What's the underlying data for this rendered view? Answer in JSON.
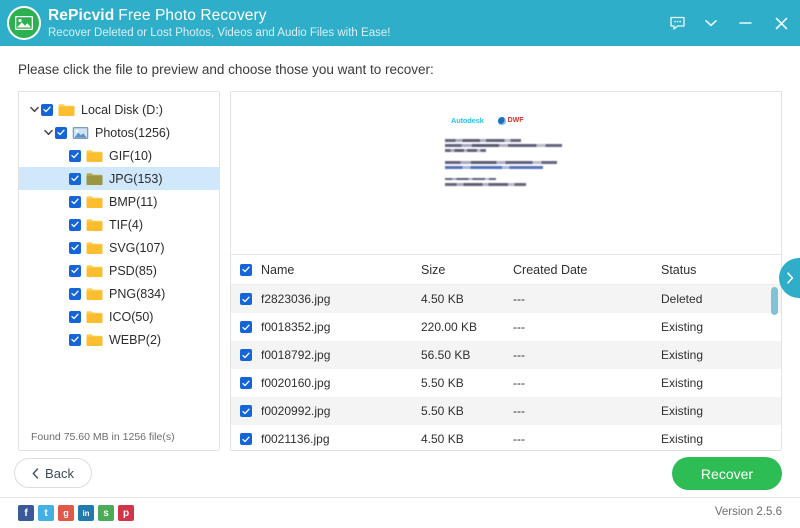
{
  "window": {
    "brand": "RePicvid",
    "product": "Free Photo Recovery",
    "tagline": "Recover Deleted or Lost Photos, Videos and Audio Files with Ease!",
    "logo_icon": "photo-icon",
    "controls": [
      {
        "name": "feedback-button",
        "icon": "chat-bubble-icon"
      },
      {
        "name": "menu-button",
        "icon": "chevron-down-icon"
      },
      {
        "name": "minimize-button",
        "icon": "minimize-icon"
      },
      {
        "name": "close-button",
        "icon": "close-icon"
      }
    ],
    "header_color": "#2eaec8"
  },
  "instruction": "Please click the file to preview and choose those you want to recover:",
  "tree": {
    "items": [
      {
        "label": "Local Disk (D:)",
        "depth": 0,
        "checked": true,
        "expanded": true,
        "icon": "folder-icon",
        "selected": false
      },
      {
        "label": "Photos(1256)",
        "depth": 1,
        "checked": true,
        "expanded": true,
        "icon": "picture-icon",
        "selected": false
      },
      {
        "label": "GIF(10)",
        "depth": 2,
        "checked": true,
        "expanded": null,
        "icon": "folder-icon",
        "selected": false
      },
      {
        "label": "JPG(153)",
        "depth": 2,
        "checked": true,
        "expanded": null,
        "icon": "folder-icon-selected",
        "selected": true
      },
      {
        "label": "BMP(11)",
        "depth": 2,
        "checked": true,
        "expanded": null,
        "icon": "folder-icon",
        "selected": false
      },
      {
        "label": "TIF(4)",
        "depth": 2,
        "checked": true,
        "expanded": null,
        "icon": "folder-icon",
        "selected": false
      },
      {
        "label": "SVG(107)",
        "depth": 2,
        "checked": true,
        "expanded": null,
        "icon": "folder-icon",
        "selected": false
      },
      {
        "label": "PSD(85)",
        "depth": 2,
        "checked": true,
        "expanded": null,
        "icon": "folder-icon",
        "selected": false
      },
      {
        "label": "PNG(834)",
        "depth": 2,
        "checked": true,
        "expanded": null,
        "icon": "folder-icon",
        "selected": false
      },
      {
        "label": "ICO(50)",
        "depth": 2,
        "checked": true,
        "expanded": null,
        "icon": "folder-icon",
        "selected": false
      },
      {
        "label": "WEBP(2)",
        "depth": 2,
        "checked": true,
        "expanded": null,
        "icon": "folder-icon",
        "selected": false
      }
    ],
    "found_text": "Found 75.60 MB in 1256 file(s)"
  },
  "preview": {
    "doc_logo_left": "Autodesk",
    "doc_logo_right": "DWF",
    "doc_logo_right_icon": "globe-icon"
  },
  "file_table": {
    "header_checkbox_checked": true,
    "columns": [
      "Name",
      "Size",
      "Created Date",
      "Status"
    ],
    "rows": [
      {
        "checked": true,
        "name": "f2823036.jpg",
        "size": "4.50 KB",
        "created": "---",
        "status": "Deleted"
      },
      {
        "checked": true,
        "name": "f0018352.jpg",
        "size": "220.00 KB",
        "created": "---",
        "status": "Existing"
      },
      {
        "checked": true,
        "name": "f0018792.jpg",
        "size": "56.50 KB",
        "created": "---",
        "status": "Existing"
      },
      {
        "checked": true,
        "name": "f0020160.jpg",
        "size": "5.50 KB",
        "created": "---",
        "status": "Existing"
      },
      {
        "checked": true,
        "name": "f0020992.jpg",
        "size": "5.50 KB",
        "created": "---",
        "status": "Existing"
      },
      {
        "checked": true,
        "name": "f0021136.jpg",
        "size": "4.50 KB",
        "created": "---",
        "status": "Existing"
      }
    ]
  },
  "side_tab": {
    "icon": "chevron-right-icon",
    "color": "#2eaec8"
  },
  "actions": {
    "back_label": "Back",
    "back_icon": "chevron-left-icon",
    "recover_label": "Recover",
    "recover_color": "#2ebd54"
  },
  "footer": {
    "version": "Version 2.5.6",
    "socials": [
      {
        "name": "facebook-icon",
        "glyph": "f",
        "color": "#3b5998"
      },
      {
        "name": "twitter-icon",
        "glyph": "t",
        "color": "#45b0e3"
      },
      {
        "name": "googleplus-icon",
        "glyph": "g",
        "color": "#e0584a"
      },
      {
        "name": "linkedin-icon",
        "glyph": "in",
        "color": "#2279ad"
      },
      {
        "name": "stumbleupon-icon",
        "glyph": "s",
        "color": "#4cab56"
      },
      {
        "name": "pinterest-icon",
        "glyph": "p",
        "color": "#d2344a"
      }
    ]
  }
}
